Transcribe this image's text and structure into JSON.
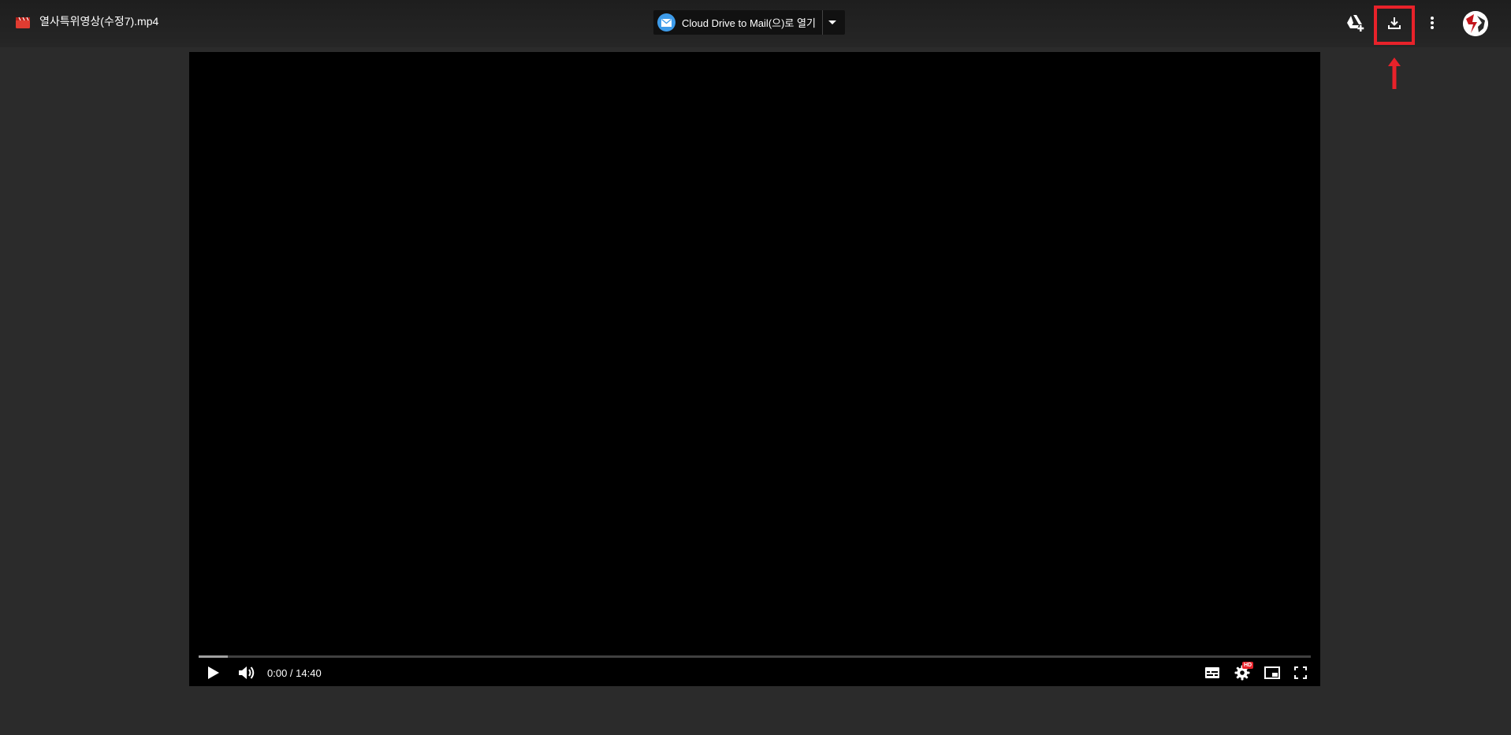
{
  "header": {
    "file_title": "열사특위영상(수정7).mp4",
    "file_icon": "video-file-icon",
    "open_with": {
      "label": "Cloud Drive to Mail(으)로 열기",
      "icon": "mail-icon",
      "dropdown_icon": "caret-down-icon"
    },
    "actions": [
      {
        "name": "add-to-drive",
        "icon": "drive-add-icon"
      },
      {
        "name": "download",
        "icon": "download-icon",
        "highlighted": true
      },
      {
        "name": "more-options",
        "icon": "more-vert-icon"
      },
      {
        "name": "account",
        "icon": "avatar"
      }
    ]
  },
  "annotation": {
    "highlight_color": "#e8222a",
    "arrow_icon": "arrow-up-icon"
  },
  "player": {
    "current_time": "0:00",
    "separator": " / ",
    "duration": "14:40",
    "progress_buffered_fraction": 0.026,
    "controls": {
      "play_icon": "play-icon",
      "volume_icon": "volume-icon",
      "subtitles_icon": "subtitles-icon",
      "settings_icon": "settings-icon",
      "settings_badge": "HD",
      "miniplayer_icon": "miniplayer-icon",
      "fullscreen_icon": "fullscreen-icon"
    }
  },
  "colors": {
    "page_background": "#2b2b2b",
    "video_background": "#000000",
    "accent_red": "#e8222a",
    "mail_blue": "#3d9be9"
  }
}
